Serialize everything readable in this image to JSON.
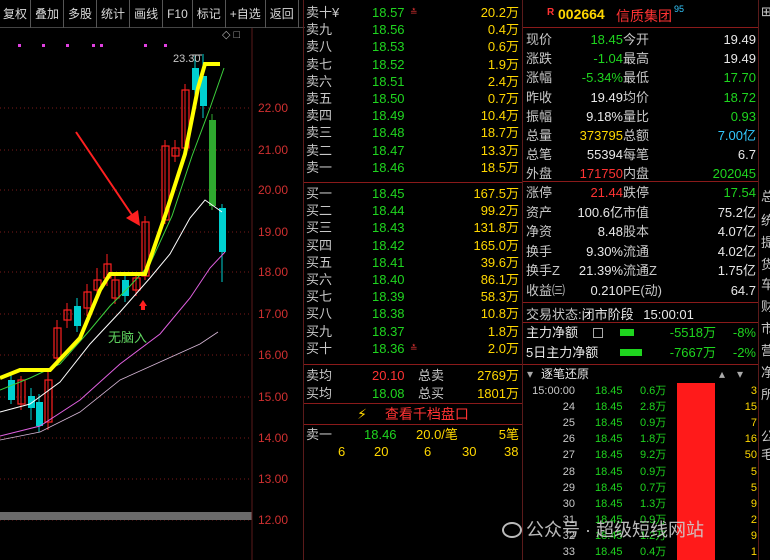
{
  "toolbar": [
    "复权",
    "叠加",
    "多股",
    "统计",
    "画线",
    "F10",
    "标记",
    "+自选",
    "返回"
  ],
  "chart": {
    "high_label": "23.30",
    "annotation": "无脑入",
    "price_axis": [
      "22.00",
      "21.00",
      "20.00",
      "19.00",
      "18.00",
      "17.00",
      "16.00",
      "15.00",
      "14.00",
      "13.00",
      "12.00"
    ],
    "controls": "◇ □",
    "colors": {
      "up": "#ff2020",
      "down": "#00d0d0",
      "ma_thick": "#ffff00",
      "ma1": "#ffffff",
      "ma2": "#3cd03c",
      "ma3": "#e060e0"
    }
  },
  "order_book": {
    "sell": [
      {
        "label": "卖十¥",
        "price": "18.57",
        "vol": "20.2万",
        "mark": "≛"
      },
      {
        "label": "卖九",
        "price": "18.56",
        "vol": "0.4万"
      },
      {
        "label": "卖八",
        "price": "18.53",
        "vol": "0.6万"
      },
      {
        "label": "卖七",
        "price": "18.52",
        "vol": "1.9万"
      },
      {
        "label": "卖六",
        "price": "18.51",
        "vol": "2.4万"
      },
      {
        "label": "卖五",
        "price": "18.50",
        "vol": "0.7万"
      },
      {
        "label": "卖四",
        "price": "18.49",
        "vol": "10.4万"
      },
      {
        "label": "卖三",
        "price": "18.48",
        "vol": "18.7万"
      },
      {
        "label": "卖二",
        "price": "18.47",
        "vol": "13.3万"
      },
      {
        "label": "卖一",
        "price": "18.46",
        "vol": "18.5万"
      }
    ],
    "buy": [
      {
        "label": "买一",
        "price": "18.45",
        "vol": "167.5万"
      },
      {
        "label": "买二",
        "price": "18.44",
        "vol": "99.2万"
      },
      {
        "label": "买三",
        "price": "18.43",
        "vol": "131.8万"
      },
      {
        "label": "买四",
        "price": "18.42",
        "vol": "165.0万"
      },
      {
        "label": "买五",
        "price": "18.41",
        "vol": "39.6万"
      },
      {
        "label": "买六",
        "price": "18.40",
        "vol": "86.1万"
      },
      {
        "label": "买七",
        "price": "18.39",
        "vol": "58.3万"
      },
      {
        "label": "买八",
        "price": "18.38",
        "vol": "10.8万"
      },
      {
        "label": "买九",
        "price": "18.37",
        "vol": "1.8万"
      },
      {
        "label": "买十",
        "price": "18.36",
        "vol": "2.0万",
        "mark": "≛"
      }
    ],
    "avg_sell": {
      "label": "卖均",
      "price": "20.10",
      "tlabel": "总卖",
      "total": "2769万"
    },
    "avg_buy": {
      "label": "买均",
      "price": "18.08",
      "tlabel": "总买",
      "total": "1801万"
    },
    "view_link": "查看千档盘口",
    "queue": {
      "label": "卖一",
      "price": "18.46",
      "vol": "20.0/笔",
      "count": "5笔"
    },
    "queue_vals": [
      "6",
      "20",
      "6",
      "30",
      "38"
    ]
  },
  "info": {
    "badge": "R",
    "code": "002664",
    "name": "信质集团",
    "superscript": "95",
    "rows": [
      {
        "l1": "现价",
        "v1": "18.45",
        "c1": "green",
        "l2": "今开",
        "v2": "19.49",
        "c2": "white"
      },
      {
        "l1": "涨跌",
        "v1": "-1.04",
        "c1": "green",
        "l2": "最高",
        "v2": "19.49",
        "c2": "white"
      },
      {
        "l1": "涨幅",
        "v1": "-5.34%",
        "c1": "green",
        "l2": "最低",
        "v2": "17.70",
        "c2": "green"
      },
      {
        "l1": "昨收",
        "v1": "19.49",
        "c1": "white",
        "l2": "均价",
        "v2": "18.72",
        "c2": "green"
      },
      {
        "l1": "振幅",
        "v1": "9.18%",
        "c1": "white",
        "l2": "量比",
        "v2": "0.93",
        "c2": "green"
      },
      {
        "l1": "总量",
        "v1": "373795",
        "c1": "yellow",
        "l2": "总额",
        "v2": "7.00亿",
        "c2": "cyan"
      },
      {
        "l1": "总笔",
        "v1": "55394",
        "c1": "white",
        "l2": "每笔",
        "v2": "6.7",
        "c2": "white"
      },
      {
        "l1": "外盘",
        "v1": "171750",
        "c1": "red",
        "l2": "内盘",
        "v2": "202045",
        "c2": "green"
      },
      {
        "l1": "涨停",
        "v1": "21.44",
        "c1": "red",
        "l2": "跌停",
        "v2": "17.54",
        "c2": "green"
      },
      {
        "l1": "资产",
        "v1": "100.6亿",
        "c1": "white",
        "l2": "市值",
        "v2": "75.2亿",
        "c2": "white"
      },
      {
        "l1": "净资",
        "v1": "8.48",
        "c1": "white",
        "l2": "股本",
        "v2": "4.07亿",
        "c2": "white"
      },
      {
        "l1": "换手",
        "v1": "9.30%",
        "c1": "white",
        "l2": "流通",
        "v2": "4.02亿",
        "c2": "white"
      },
      {
        "l1": "换手Z",
        "v1": "21.39%",
        "c1": "white",
        "l2": "流通Z",
        "v2": "1.75亿",
        "c2": "white"
      },
      {
        "l1": "收益㈢",
        "v1": "0.210",
        "c1": "white",
        "l2": "PE(动)",
        "v2": "64.7",
        "c2": "white"
      }
    ],
    "trade_status_label": "交易状态:",
    "trade_status": "闭市阶段",
    "trade_time": "15:00:01",
    "main_flow": {
      "label": "主力净额",
      "value": "-5518万",
      "pct": "-8%"
    },
    "five_day_flow": {
      "label": "5日主力净额",
      "value": "-7667万",
      "pct": "-2%"
    },
    "ticks_title": "逐笔还原",
    "ticks": [
      {
        "t": "15:00:00",
        "p": "18.45",
        "v": "0.6万"
      },
      {
        "t": "24",
        "p": "18.45",
        "v": "2.8万"
      },
      {
        "t": "25",
        "p": "18.45",
        "v": "0.9万"
      },
      {
        "t": "26",
        "p": "18.45",
        "v": "1.8万"
      },
      {
        "t": "27",
        "p": "18.45",
        "v": "9.2万"
      },
      {
        "t": "28",
        "p": "18.45",
        "v": "0.9万"
      },
      {
        "t": "29",
        "p": "18.45",
        "v": "0.7万"
      },
      {
        "t": "30",
        "p": "18.45",
        "v": "1.3万"
      },
      {
        "t": "31",
        "p": "18.45",
        "v": "0.9万"
      },
      {
        "t": "32",
        "p": "18.45",
        "v": "1.2万"
      },
      {
        "t": "33",
        "p": "18.45",
        "v": "0.4万"
      }
    ],
    "tick_counts": [
      "3",
      "15",
      "7",
      "16",
      "50",
      "5",
      "5",
      "9",
      "2",
      "9",
      "1"
    ]
  },
  "edge_chars": [
    "⊞",
    "总",
    "统",
    "提",
    "货",
    "车",
    "财",
    "市",
    "营",
    "净",
    "所",
    "公",
    "毛"
  ],
  "watermark": "公众号 · 超级短线网站"
}
